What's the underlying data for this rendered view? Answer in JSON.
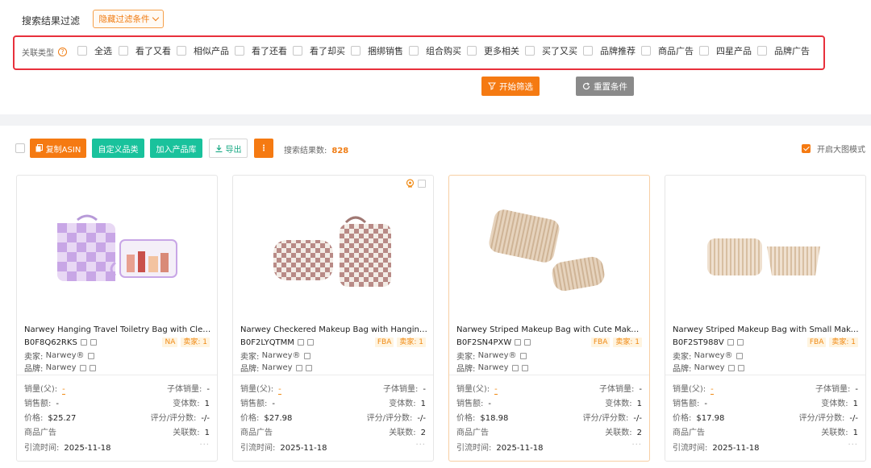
{
  "filter": {
    "title": "搜索结果过滤",
    "hide_button": "隐藏过滤条件",
    "relation_label": "关联类型",
    "help_glyph": "?",
    "relation_types": [
      "全选",
      "看了又看",
      "相似产品",
      "看了还看",
      "看了却买",
      "捆绑销售",
      "组合购买",
      "更多相关",
      "买了又买",
      "品牌推荐",
      "商品广告",
      "四星产品",
      "品牌广告"
    ],
    "start_button": "开始筛选",
    "reset_button": "重置条件"
  },
  "toolbar": {
    "copy_asin": "复制ASIN",
    "custom_category": "自定义品类",
    "add_library": "加入产品库",
    "export": "导出",
    "more": "⋮",
    "result_count_label": "搜索结果数:",
    "result_count": "828",
    "big_view_label": "开启大图模式"
  },
  "labels": {
    "seller": "卖家:",
    "brand": "品牌:",
    "sales_parent": "销量(父):",
    "sub_sales": "子体销量:",
    "revenue": "销售额:",
    "variants": "变体数:",
    "price": "价格:",
    "rating": "评分/评分数:",
    "traffic_time": "引流时间:",
    "related_count": "关联数:",
    "dots": "···"
  },
  "products": [
    {
      "title": "Narwey Hanging Travel Toiletry Bag with Clear Makeup Bag",
      "asin": "B0F8Q62RKS",
      "fulfillment": "NA",
      "seller_badge": "卖家: 1",
      "seller": "Narwey®",
      "brand": "Narwey",
      "sales_parent": "-",
      "sub_sales": "-",
      "revenue": "-",
      "variants": "1",
      "price": "$25.27",
      "rating": "-/-",
      "ad_label": "商品广告",
      "related_count": "1",
      "traffic_time": "2025-11-18"
    },
    {
      "title": "Narwey Checkered Makeup Bag with Hanging Hook",
      "asin": "B0F2LYQTMM",
      "fulfillment": "FBA",
      "seller_badge": "卖家: 1",
      "seller": "Narwey®",
      "brand": "Narwey",
      "sales_parent": "-",
      "sub_sales": "-",
      "revenue": "-",
      "variants": "1",
      "price": "$27.98",
      "rating": "-/-",
      "ad_label": "商品广告",
      "related_count": "2",
      "traffic_time": "2025-11-18"
    },
    {
      "title": "Narwey Striped Makeup Bag with Cute Makeup Pouch",
      "asin": "B0F2SN4PXW",
      "fulfillment": "FBA",
      "seller_badge": "卖家: 1",
      "seller": "Narwey®",
      "brand": "Narwey",
      "sales_parent": "-",
      "sub_sales": "-",
      "revenue": "-",
      "variants": "1",
      "price": "$18.98",
      "rating": "-/-",
      "ad_label": "商品广告",
      "related_count": "2",
      "traffic_time": "2025-11-18"
    },
    {
      "title": "Narwey Striped Makeup Bag with Small Makeup Pouch",
      "asin": "B0F2ST988V",
      "fulfillment": "FBA",
      "seller_badge": "卖家: 1",
      "seller": "Narwey®",
      "brand": "Narwey",
      "sales_parent": "-",
      "sub_sales": "-",
      "revenue": "-",
      "variants": "1",
      "price": "$17.98",
      "rating": "-/-",
      "ad_label": "商品广告",
      "related_count": "1",
      "traffic_time": "2025-11-18"
    }
  ],
  "colors": {
    "accent_orange": "#f57a12",
    "accent_green": "#19c29c",
    "highlight_red": "#e8303c",
    "gray_button": "#8a8a8a"
  }
}
